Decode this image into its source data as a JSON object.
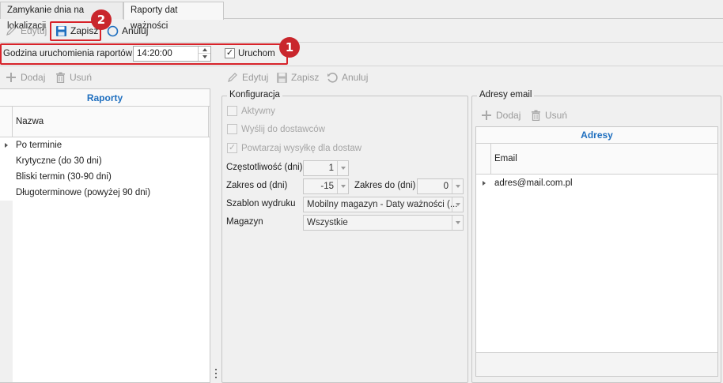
{
  "tabs": [
    {
      "label": "Zamykanie dnia na lokalizacji",
      "active": false
    },
    {
      "label": "Raporty dat ważności",
      "active": true
    }
  ],
  "main_toolbar": {
    "edit_label": "Edytuj",
    "save_label": "Zapisz",
    "cancel_label": "Anuluj"
  },
  "schedule": {
    "time_label": "Godzina uruchomienia raportów",
    "time_value": "14:20:00",
    "run_label": "Uruchom",
    "run_checked": true
  },
  "badges": {
    "one": "1",
    "two": "2"
  },
  "left_toolbar": {
    "add_label": "Dodaj",
    "remove_label": "Usuń"
  },
  "reports_grid": {
    "title": "Raporty",
    "column": "Nazwa",
    "rows": [
      "Po terminie",
      "Krytyczne (do 30 dni)",
      "Bliski termin (30-90 dni)",
      "Długoterminowe (powyżej 90 dni)"
    ]
  },
  "right_toolbar": {
    "edit_label": "Edytuj",
    "save_label": "Zapisz",
    "cancel_label": "Anuluj"
  },
  "config": {
    "title": "Konfiguracja",
    "active_label": "Aktywny",
    "send_suppliers_label": "Wyślij do dostawców",
    "repeat_label": "Powtarzaj wysyłkę dla dostaw",
    "frequency_label": "Częstotliwość (dni)",
    "frequency_value": "1",
    "range_from_label": "Zakres od (dni)",
    "range_from_value": "-15",
    "range_to_label": "Zakres do (dni)",
    "range_to_value": "0",
    "template_label": "Szablon wydruku",
    "template_value": "Mobilny magazyn - Daty ważności (...",
    "warehouse_label": "Magazyn",
    "warehouse_value": "Wszystkie"
  },
  "email": {
    "title": "Adresy email",
    "add_label": "Dodaj",
    "remove_label": "Usuń",
    "grid_title": "Adresy",
    "column": "Email",
    "rows": [
      "adres@mail.com.pl"
    ]
  },
  "colors": {
    "accent_red": "#d7232a",
    "header_blue": "#1f6fbf",
    "save_icon": "#1f6fbf"
  }
}
